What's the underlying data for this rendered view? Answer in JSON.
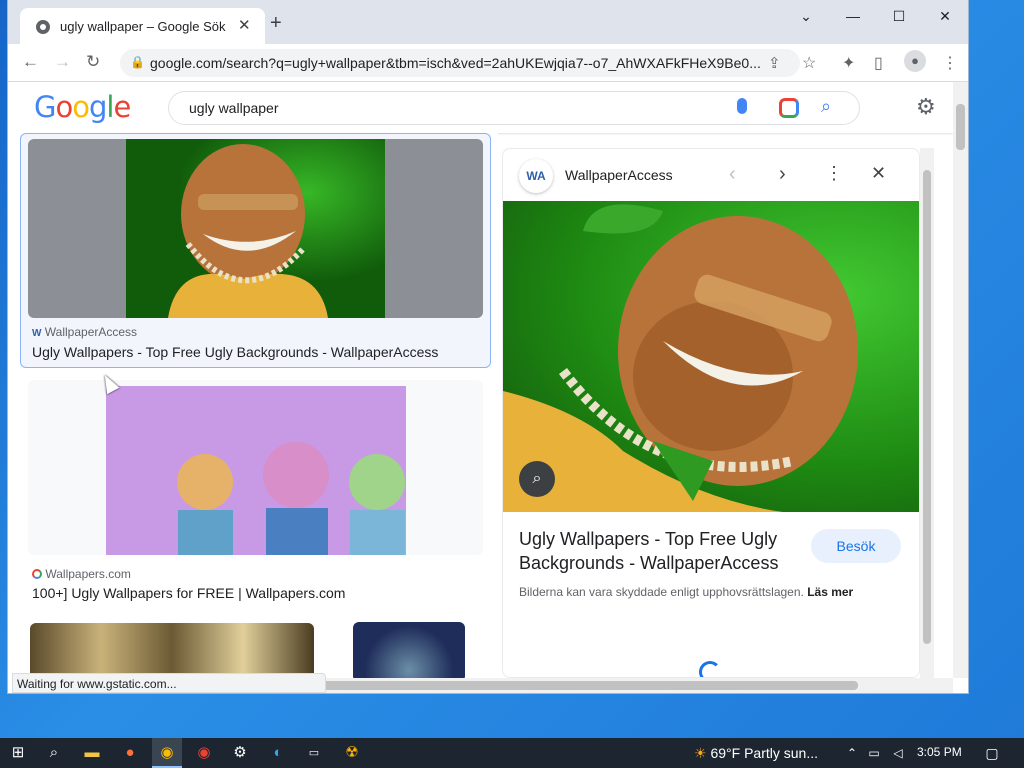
{
  "browser": {
    "tab_title": "ugly wallpaper – Google Sök",
    "new_tab": "+",
    "url": "google.com/search?q=ugly+wallpaper&tbm=isch&ved=2ahUKEwjqia7--o7_AhWXAFkFHeX9Be0...",
    "status_text": "Waiting for www.gstatic.com..."
  },
  "google": {
    "logo": [
      "G",
      "o",
      "o",
      "g",
      "l",
      "e"
    ],
    "query": "ugly wallpaper"
  },
  "results": [
    {
      "source": "WallpaperAccess",
      "title": "Ugly Wallpapers - Top Free Ugly Backgrounds - WallpaperAccess"
    },
    {
      "source": "Wallpapers.com",
      "title": "100+] Ugly Wallpapers for FREE | Wallpapers.com"
    }
  ],
  "panel": {
    "source": "WallpaperAccess",
    "source_logo": "WA",
    "title": "Ugly Wallpapers - Top Free Ugly Backgrounds - WallpaperAccess",
    "visit_label": "Besök",
    "copyright_note": "Bilderna kan vara skyddade enligt upphovsrättslagen.",
    "learn_more": "Läs mer"
  },
  "taskbar": {
    "weather": "69°F  Partly sun...",
    "time": "3:05 PM"
  },
  "colors": {
    "accent": "#1a73e8",
    "selected_border": "#8ab4f8",
    "taskbar": "#1c2530"
  },
  "icons": [
    "windows-start-icon",
    "search-icon",
    "file-explorer-icon",
    "firefox-icon",
    "chrome-icon",
    "settings-icon",
    "edge-icon",
    "terminal-icon"
  ]
}
